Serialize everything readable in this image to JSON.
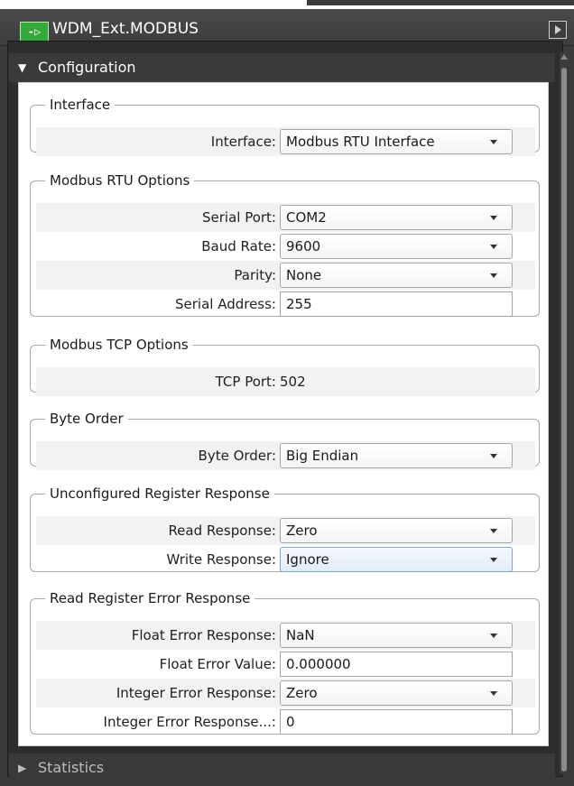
{
  "window": {
    "title": "WDM_Ext.MODBUS",
    "icon_text": "-▷"
  },
  "sections": {
    "configuration": "Configuration",
    "statistics": "Statistics"
  },
  "groups": {
    "interface": {
      "legend": "Interface",
      "rows": {
        "interface": {
          "label": "Interface:",
          "value": "Modbus RTU Interface"
        }
      }
    },
    "rtu": {
      "legend": "Modbus RTU Options",
      "rows": {
        "serial_port": {
          "label": "Serial Port:",
          "value": "COM2"
        },
        "baud_rate": {
          "label": "Baud Rate:",
          "value": "9600"
        },
        "parity": {
          "label": "Parity:",
          "value": "None"
        },
        "serial_address": {
          "label": "Serial Address:",
          "value": "255"
        }
      }
    },
    "tcp": {
      "legend": "Modbus TCP Options",
      "rows": {
        "tcp_port": {
          "label": "TCP Port:",
          "value": "502"
        }
      }
    },
    "byte_order": {
      "legend": "Byte Order",
      "rows": {
        "byte_order": {
          "label": "Byte Order:",
          "value": "Big Endian"
        }
      }
    },
    "unconfigured": {
      "legend": "Unconfigured Register Response",
      "rows": {
        "read_response": {
          "label": "Read Response:",
          "value": "Zero"
        },
        "write_response": {
          "label": "Write Response:",
          "value": "Ignore"
        }
      }
    },
    "read_error": {
      "legend": "Read Register Error Response",
      "rows": {
        "float_error_response": {
          "label": "Float Error Response:",
          "value": "NaN"
        },
        "float_error_value": {
          "label": "Float Error Value:",
          "value": "0.000000"
        },
        "integer_error_response": {
          "label": "Integer Error Response:",
          "value": "Zero"
        },
        "integer_error_response_value": {
          "label": "Integer Error Response...:",
          "value": "0"
        }
      }
    }
  },
  "icons": {
    "app": "modbus-app-icon",
    "collapse": "triangle-right-icon",
    "expanded": "triangle-down-icon",
    "collapsed": "triangle-right-icon",
    "dropdown": "chevron-down-icon"
  },
  "colors": {
    "app_icon": "#35a83b",
    "chrome_dark": "#3b3b3b",
    "active_dropdown": "#7ba3d8"
  }
}
